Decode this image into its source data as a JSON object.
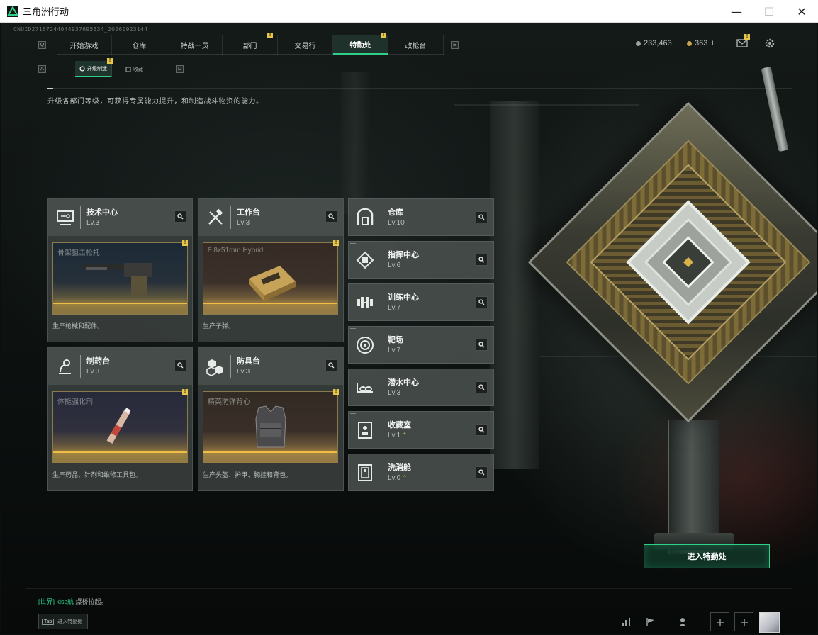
{
  "window": {
    "title": "三角洲行动",
    "min": "—",
    "max": "☐",
    "close": "✕"
  },
  "session_id": "CNUID27167244044937695534_20260923144",
  "nav": {
    "left_key": "Q",
    "right_key": "E",
    "tabs": [
      {
        "label": "开始游戏",
        "badge": false
      },
      {
        "label": "仓库",
        "badge": false
      },
      {
        "label": "特战干员",
        "badge": false
      },
      {
        "label": "部门",
        "badge": true
      },
      {
        "label": "交易行",
        "badge": false
      },
      {
        "label": "特勤处",
        "badge": true,
        "active": true
      },
      {
        "label": "改枪台",
        "badge": false
      }
    ]
  },
  "currency": {
    "coupons": "233,463",
    "gold": "363",
    "plus": "+"
  },
  "subtabs": {
    "left_key": "A",
    "right_key": "D",
    "items": [
      {
        "label": "升级制造",
        "active": true,
        "badge": true
      },
      {
        "label": "收藏",
        "active": false
      }
    ]
  },
  "description": "升级各部门等级，可获得专属能力提升，和制造战斗物资的能力。",
  "departments": [
    {
      "name": "技术中心",
      "level": "Lv.3",
      "icon": "monitor-icon",
      "product": "骨架狙击枪托",
      "product_desc": "生产枪械和配件。",
      "badge": true
    },
    {
      "name": "工作台",
      "level": "Lv.3",
      "icon": "tools-icon",
      "product": "8.8x51mm Hybrid",
      "product_desc": "生产子弹。",
      "badge": true
    },
    {
      "name": "制药台",
      "level": "Lv.3",
      "icon": "microscope-icon",
      "product": "体能强化剂",
      "product_desc": "生产药品、针剂和维修工具包。",
      "badge": true
    },
    {
      "name": "防具台",
      "level": "Lv.3",
      "icon": "blocks-icon",
      "product": "精英防弹背心",
      "product_desc": "生产头盔、护甲、胸挂和背包。",
      "badge": true
    }
  ],
  "side_departments": [
    {
      "name": "仓库",
      "level": "Lv.10",
      "icon": "vault-icon",
      "upgrade": false
    },
    {
      "name": "指挥中心",
      "level": "Lv.6",
      "icon": "chip-icon",
      "upgrade": false
    },
    {
      "name": "训练中心",
      "level": "Lv.7",
      "icon": "dumbbell-icon",
      "upgrade": false
    },
    {
      "name": "靶场",
      "level": "Lv.7",
      "icon": "target-icon",
      "upgrade": false
    },
    {
      "name": "潜水中心",
      "level": "Lv.3",
      "icon": "diving-mask-icon",
      "upgrade": false
    },
    {
      "name": "收藏室",
      "level": "Lv.1",
      "icon": "display-case-icon",
      "upgrade": true
    },
    {
      "name": "洗消舱",
      "level": "Lv.0",
      "icon": "decon-pod-icon",
      "upgrade": true
    }
  ],
  "enter_button": "进入特勤处",
  "chat": {
    "channel": "[世界]",
    "user": "kiss航",
    "message": "爆桥拉起。"
  },
  "tab_hint": {
    "key": "Tab",
    "label": "进入特勤处"
  },
  "upgrade_glyph": "⌃",
  "badge_glyph": "!",
  "colors": {
    "accent": "#2fd08a",
    "badge": "#e8c64a",
    "product_glow": "#f0bd46"
  }
}
